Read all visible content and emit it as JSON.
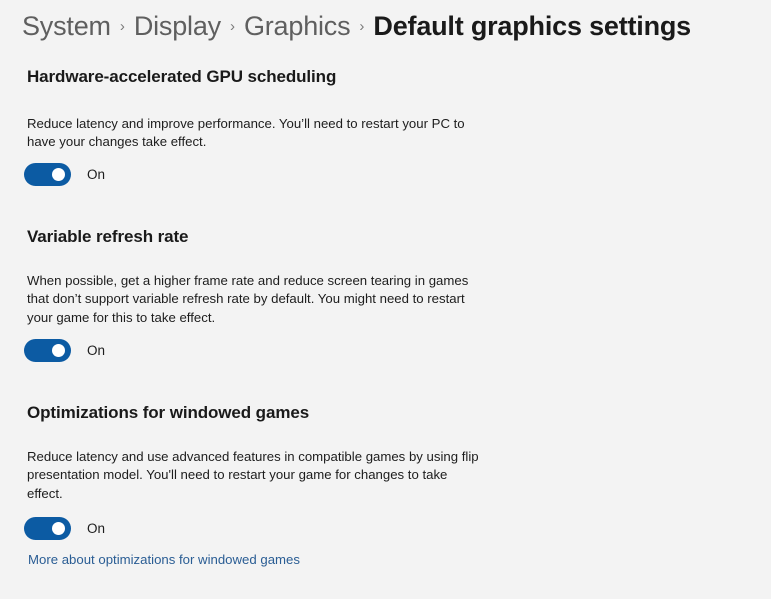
{
  "breadcrumb": {
    "separator": "›",
    "items": [
      {
        "label": "System",
        "current": false
      },
      {
        "label": "Display",
        "current": false
      },
      {
        "label": "Graphics",
        "current": false
      },
      {
        "label": "Default graphics settings",
        "current": true
      }
    ]
  },
  "sections": [
    {
      "title": "Hardware-accelerated GPU scheduling",
      "description": "Reduce latency and improve performance. You’ll need to restart your PC to have your changes take effect.",
      "toggle": {
        "state": "On",
        "label": "On",
        "checked": true
      }
    },
    {
      "title": "Variable refresh rate",
      "description": "When possible, get a higher frame rate and reduce screen tearing in games that don’t support variable refresh rate by default. You might need to restart your game for this to take effect.",
      "toggle": {
        "state": "On",
        "label": "On",
        "checked": true
      }
    },
    {
      "title": "Optimizations for windowed games",
      "description": "Reduce latency and use advanced features in compatible games by using flip presentation model. You'll need to restart your game for changes to take effect.",
      "toggle": {
        "state": "On",
        "label": "On",
        "checked": true
      },
      "link": "More about optimizations for windowed games"
    }
  ],
  "colors": {
    "background": "#f3f3f3",
    "accent": "#0c5ba3",
    "link": "#2a5d94",
    "text": "#1b1b1b",
    "muted_text": "#5f5f5f"
  }
}
